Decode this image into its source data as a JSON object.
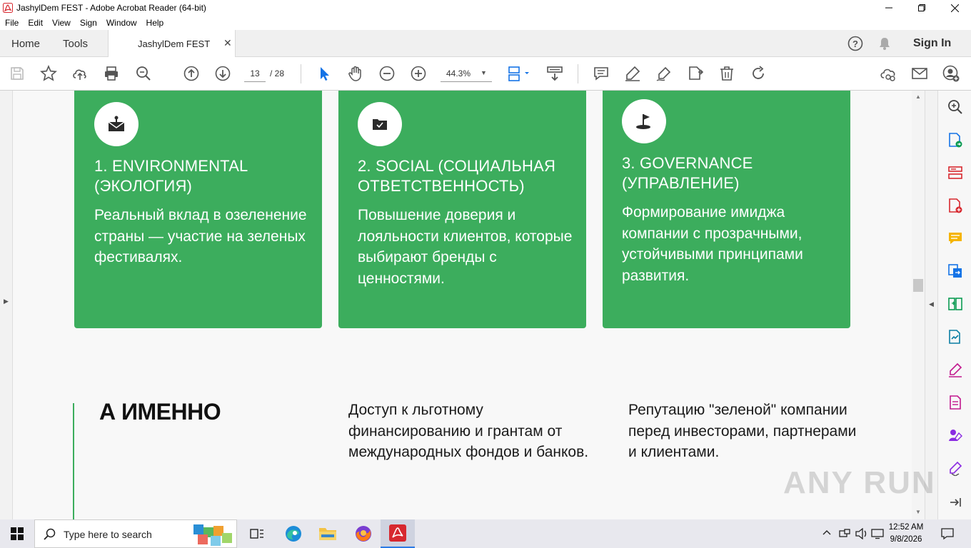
{
  "window": {
    "title": "JashylDem FEST - Adobe Acrobat Reader (64-bit)"
  },
  "menu": [
    "File",
    "Edit",
    "View",
    "Sign",
    "Window",
    "Help"
  ],
  "tabs": {
    "home": "Home",
    "tools": "Tools",
    "document": "JashylDem FEST",
    "sign_in": "Sign In"
  },
  "toolbar": {
    "page_current": "13",
    "page_total": "/ 28",
    "zoom": "44.3%"
  },
  "document": {
    "cards": [
      {
        "icon": "envelope-upload-icon",
        "heading": "1. ENVIRONMENTAL (ЭКОЛОГИЯ)",
        "body": "Реальный вклад в озеленение страны — участие на зеленых фестивалях."
      },
      {
        "icon": "folder-check-icon",
        "heading": "2. SOCIAL (СОЦИАЛЬНАЯ ОТВЕТСТВЕННОСТЬ)",
        "body": "Повышение доверия и лояльности клиентов, которые выбирают бренды с ценностями."
      },
      {
        "icon": "flag-icon",
        "heading": "3. GOVERNANCE (УПРАВЛЕНИЕ)",
        "body": "Формирование имиджа компании с прозрачными, устойчивыми принципами развития."
      }
    ],
    "section_title": "А ИМЕННО",
    "section_col1": "Доступ к льготному финансированию и грантам от международных фондов и банков.",
    "section_col2": "Репутацию \"зеленой\" компании перед инвесторами, партнерами и клиентами."
  },
  "taskbar": {
    "search_placeholder": "Type here to search",
    "time": "12:52 AM",
    "date": "9/8/2026"
  },
  "watermark": "ANY RUN",
  "colors": {
    "card_green": "#3cad5d",
    "acrobat_red": "#d7282f",
    "toolbar_blue": "#1473e6"
  }
}
